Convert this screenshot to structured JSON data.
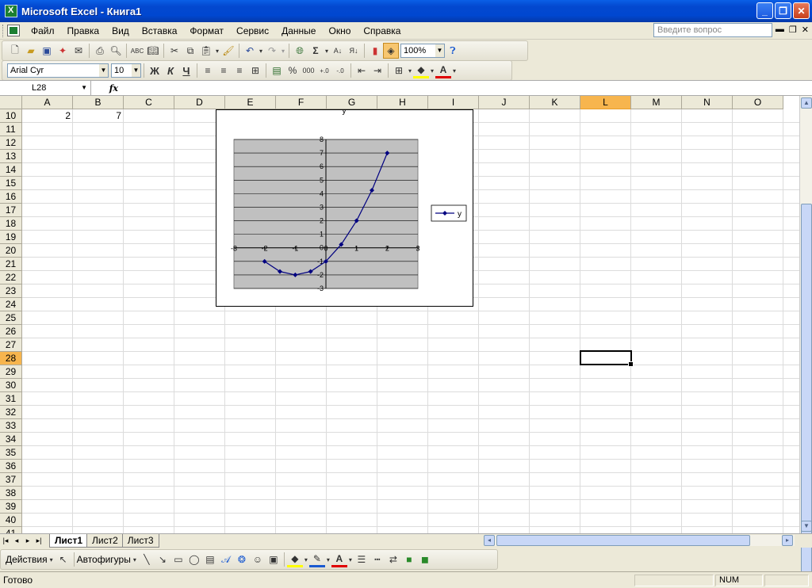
{
  "window": {
    "title": "Microsoft Excel - Книга1"
  },
  "menu": {
    "items": [
      "Файл",
      "Правка",
      "Вид",
      "Вставка",
      "Формат",
      "Сервис",
      "Данные",
      "Окно",
      "Справка"
    ],
    "ask_placeholder": "Введите вопрос"
  },
  "standard_toolbar": {
    "zoom": "100%",
    "icons": [
      "new-icon",
      "open-icon",
      "save-icon",
      "permission-icon",
      "email-icon",
      "print-icon",
      "print-preview-icon",
      "spelling-icon",
      "research-icon",
      "cut-icon",
      "copy-icon",
      "paste-icon",
      "format-painter-icon",
      "undo-icon",
      "redo-icon",
      "hyperlink-icon",
      "autosum-icon",
      "sort-ascending-icon",
      "sort-descending-icon",
      "chart-wizard-icon",
      "drawing-icon",
      "help-icon"
    ]
  },
  "format_toolbar": {
    "font": "Arial Cyr",
    "size": "10",
    "bold": "Ж",
    "italic": "К",
    "underline": "Ч",
    "percent": "%",
    "thousands": "000",
    "inc_decimal": ",0\n,00",
    "dec_decimal": ",00\n,0"
  },
  "formula_bar": {
    "name_box": "L28",
    "fx": "fx",
    "formula": ""
  },
  "grid": {
    "columns": [
      "A",
      "B",
      "C",
      "D",
      "E",
      "F",
      "G",
      "H",
      "I",
      "J",
      "K",
      "L",
      "M",
      "N",
      "O"
    ],
    "active_column": "L",
    "rows": [
      "10",
      "11",
      "12",
      "13",
      "14",
      "15",
      "16",
      "17",
      "18",
      "19",
      "20",
      "21",
      "22",
      "23",
      "24",
      "25",
      "26",
      "27",
      "28",
      "29",
      "30",
      "31",
      "32",
      "33",
      "34",
      "35",
      "36",
      "37",
      "38",
      "39",
      "40",
      "41"
    ],
    "active_row": "28",
    "cells": [
      {
        "ref": "A10",
        "value": "2"
      },
      {
        "ref": "B10",
        "value": "7"
      }
    ]
  },
  "chart_data": {
    "type": "line",
    "title": "y",
    "x": [
      -2,
      -1.5,
      -1,
      -0.5,
      0,
      0.5,
      1,
      1.5,
      2
    ],
    "series": [
      {
        "name": "y",
        "values": [
          -1,
          -1.75,
          -2,
          -1.75,
          -1,
          0.25,
          2,
          4.25,
          7
        ],
        "color": "#000080"
      }
    ],
    "xlim": [
      -3,
      3
    ],
    "ylim": [
      -3,
      8
    ],
    "xticks": [
      "-3",
      "-2",
      "-1",
      "0",
      "1",
      "2",
      "3"
    ],
    "yticks": [
      "-3",
      "-2",
      "-1",
      "0",
      "1",
      "2",
      "3",
      "4",
      "5",
      "6",
      "7",
      "8"
    ],
    "plot_area_color": "#c0c0c0",
    "grid": true,
    "legend": "right"
  },
  "sheets": {
    "tabs": [
      "Лист1",
      "Лист2",
      "Лист3"
    ],
    "active": "Лист1"
  },
  "drawing_toolbar": {
    "actions": "Действия",
    "autoshapes": "Автофигуры"
  },
  "status": {
    "text": "Готово",
    "num": "NUM"
  }
}
